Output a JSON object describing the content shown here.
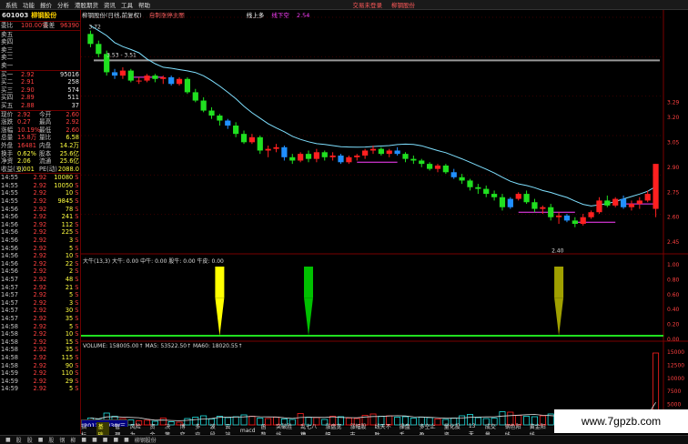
{
  "menu": {
    "items": [
      "系统",
      "功能",
      "报价",
      "分析",
      "港股期货",
      "资讯",
      "工具",
      "帮助"
    ],
    "right": [
      "交易未登录",
      "柳钢股份"
    ]
  },
  "stock": {
    "code": "601003",
    "name": "柳钢股份"
  },
  "order_book_top": [
    {
      "label": "委比",
      "v1": "100.00%",
      "l2": "委差",
      "v2": "96390"
    }
  ],
  "sells": [
    {
      "label": "卖五",
      "price": "",
      "vol": ""
    },
    {
      "label": "卖四",
      "price": "",
      "vol": ""
    },
    {
      "label": "卖三",
      "price": "",
      "vol": ""
    },
    {
      "label": "卖二",
      "price": "",
      "vol": ""
    },
    {
      "label": "卖一",
      "price": "",
      "vol": ""
    }
  ],
  "buys": [
    {
      "label": "买一",
      "price": "2.92",
      "vol": "95016"
    },
    {
      "label": "买二",
      "price": "2.91",
      "vol": "258"
    },
    {
      "label": "买三",
      "price": "2.90",
      "vol": "574"
    },
    {
      "label": "买四",
      "price": "2.89",
      "vol": "511"
    },
    {
      "label": "买五",
      "price": "2.88",
      "vol": "37"
    }
  ],
  "stats": [
    {
      "l1": "现价",
      "v1": "2.92",
      "l2": "今开",
      "v2": "2.60"
    },
    {
      "l1": "涨跌",
      "v1": "0.27",
      "l2": "最高",
      "v2": "2.92"
    },
    {
      "l1": "涨幅",
      "v1": "10.19%",
      "l2": "最低",
      "v2": "2.60"
    },
    {
      "l1": "总量",
      "v1": "15.8万",
      "l2": "量比",
      "v2": "6.58"
    },
    {
      "l1": "外盘",
      "v1": "16481",
      "l2": "内盘",
      "v2": "14.2万"
    },
    {
      "l1": "换手",
      "v1": "0.62%",
      "l2": "股本",
      "v2": "25.6亿"
    },
    {
      "l1": "净资",
      "v1": "2.06",
      "l2": "流通",
      "v2": "25.6亿"
    },
    {
      "l1": "收益(三)",
      "v1": "0.001",
      "l2": "PE(动)",
      "v2": "2088.0"
    }
  ],
  "ticks": [
    {
      "t": "14:55",
      "p": "2.92",
      "v": "10080",
      "d": "S"
    },
    {
      "t": "14:55",
      "p": "2.92",
      "v": "10050",
      "d": "S"
    },
    {
      "t": "14:55",
      "p": "2.92",
      "v": "10",
      "d": "S"
    },
    {
      "t": "14:55",
      "p": "2.92",
      "v": "9845",
      "d": "S"
    },
    {
      "t": "14:56",
      "p": "2.92",
      "v": "78",
      "d": "S"
    },
    {
      "t": "14:56",
      "p": "2.92",
      "v": "241",
      "d": "S"
    },
    {
      "t": "14:56",
      "p": "2.92",
      "v": "112",
      "d": "S"
    },
    {
      "t": "14:56",
      "p": "2.92",
      "v": "225",
      "d": "S"
    },
    {
      "t": "14:56",
      "p": "2.92",
      "v": "3",
      "d": "S"
    },
    {
      "t": "14:56",
      "p": "2.92",
      "v": "5",
      "d": "S"
    },
    {
      "t": "14:56",
      "p": "2.92",
      "v": "10",
      "d": "S"
    },
    {
      "t": "14:56",
      "p": "2.92",
      "v": "22",
      "d": "S"
    },
    {
      "t": "14:56",
      "p": "2.92",
      "v": "2",
      "d": "S"
    },
    {
      "t": "14:57",
      "p": "2.92",
      "v": "48",
      "d": "S"
    },
    {
      "t": "14:57",
      "p": "2.92",
      "v": "21",
      "d": "S"
    },
    {
      "t": "14:57",
      "p": "2.92",
      "v": "5",
      "d": "S"
    },
    {
      "t": "14:57",
      "p": "2.92",
      "v": "3",
      "d": "S"
    },
    {
      "t": "14:57",
      "p": "2.92",
      "v": "30",
      "d": "S"
    },
    {
      "t": "14:57",
      "p": "2.92",
      "v": "35",
      "d": "S"
    },
    {
      "t": "14:58",
      "p": "2.92",
      "v": "5",
      "d": "S"
    },
    {
      "t": "14:58",
      "p": "2.92",
      "v": "10",
      "d": "S"
    },
    {
      "t": "14:58",
      "p": "2.92",
      "v": "15",
      "d": "S"
    },
    {
      "t": "14:58",
      "p": "2.92",
      "v": "35",
      "d": "S"
    },
    {
      "t": "14:58",
      "p": "2.92",
      "v": "115",
      "d": "S"
    },
    {
      "t": "14:58",
      "p": "2.92",
      "v": "90",
      "d": "S"
    },
    {
      "t": "14:59",
      "p": "2.92",
      "v": "110",
      "d": "S"
    },
    {
      "t": "14:59",
      "p": "2.92",
      "v": "29",
      "d": "S"
    },
    {
      "t": "14:59",
      "p": "2.92",
      "v": "5",
      "d": "S"
    }
  ],
  "chart_title": [
    "柳钢股份(日线,前复权)",
    "自制涨停主图"
  ],
  "indicator_top": {
    "a": "线上多",
    "b": "线下空",
    "v": "2.54"
  },
  "price_labels": {
    "high": "3.72",
    "range": "3.53 - 3.51",
    "low": "2.40"
  },
  "y_price": [
    "3.29",
    "3.20",
    "3.05",
    "2.90",
    "2.75",
    "2.60",
    "2.45"
  ],
  "y_ind": [
    "1.00",
    "0.80",
    "0.60",
    "0.40",
    "0.20",
    "0.00"
  ],
  "y_vol": [
    "15000",
    "12500",
    "10000",
    "7500",
    "5000",
    "2500"
  ],
  "indicator_row": "大牛(13,3) 大牛: 0.00  中牛: 0.00  股牛: 0.00  牛皮: 0.00",
  "vol_row": "VOLUME: 158005.00↑  MA5: 53522.50↑  MA60: 18020.55↑",
  "date_label": "2012/05/30/三",
  "bottom_tabs": [
    "指标",
    "基础",
    "管理",
    "风险为",
    "资金",
    "决策",
    "博弈",
    "多空",
    "波段",
    "云端",
    "macd",
    "函数",
    "突破胜线",
    "乱七八糟",
    "涨盘宽幅",
    "涨幅股市",
    "线天不耽",
    "操盘手",
    "多空止盈",
    "量化投资",
    "13天",
    "成交量",
    "钢色阳线",
    "黄金阳线"
  ],
  "taskbar": [
    "■",
    "股",
    "股",
    "■",
    "股",
    "钢",
    "柳",
    "■",
    "■",
    "■",
    "■",
    "■",
    "柳钢股份"
  ],
  "watermark": "www.7gpzb.com",
  "candles": [
    [
      3.7,
      3.72,
      3.62,
      3.64
    ],
    [
      3.64,
      3.66,
      3.56,
      3.58
    ],
    [
      3.58,
      3.6,
      3.45,
      3.47
    ],
    [
      3.47,
      3.49,
      3.43,
      3.45
    ],
    [
      3.45,
      3.5,
      3.43,
      3.48
    ],
    [
      3.48,
      3.49,
      3.41,
      3.42
    ],
    [
      3.42,
      3.44,
      3.4,
      3.42
    ],
    [
      3.42,
      3.46,
      3.41,
      3.45
    ],
    [
      3.45,
      3.46,
      3.41,
      3.43
    ],
    [
      3.43,
      3.45,
      3.4,
      3.44
    ],
    [
      3.44,
      3.45,
      3.39,
      3.4
    ],
    [
      3.4,
      3.44,
      3.39,
      3.43
    ],
    [
      3.43,
      3.44,
      3.34,
      3.35
    ],
    [
      3.35,
      3.37,
      3.29,
      3.3
    ],
    [
      3.3,
      3.32,
      3.23,
      3.24
    ],
    [
      3.24,
      3.26,
      3.19,
      3.21
    ],
    [
      3.21,
      3.22,
      3.15,
      3.18
    ],
    [
      3.18,
      3.19,
      3.13,
      3.15
    ],
    [
      3.15,
      3.17,
      3.08,
      3.1
    ],
    [
      3.1,
      3.12,
      3.04,
      3.05
    ],
    [
      3.05,
      3.1,
      3.04,
      3.08
    ],
    [
      3.08,
      3.09,
      2.98,
      3.0
    ],
    [
      3.0,
      3.03,
      2.96,
      3.01
    ],
    [
      3.01,
      3.04,
      2.99,
      3.02
    ],
    [
      3.02,
      3.03,
      2.94,
      2.96
    ],
    [
      2.96,
      2.98,
      2.92,
      2.94
    ],
    [
      2.94,
      2.99,
      2.93,
      2.98
    ],
    [
      2.98,
      3.0,
      2.93,
      2.95
    ],
    [
      2.95,
      3.01,
      2.93,
      2.99
    ],
    [
      2.99,
      3.0,
      2.94,
      2.96
    ],
    [
      2.96,
      2.99,
      2.94,
      2.97
    ],
    [
      2.97,
      2.98,
      2.92,
      2.93
    ],
    [
      2.93,
      2.97,
      2.92,
      2.96
    ],
    [
      2.96,
      2.98,
      2.94,
      2.97
    ],
    [
      2.97,
      3.01,
      2.95,
      3.0
    ],
    [
      3.0,
      3.03,
      2.98,
      3.01
    ],
    [
      3.01,
      3.02,
      2.97,
      2.98
    ],
    [
      2.98,
      3.01,
      2.96,
      3.0
    ],
    [
      3.0,
      3.02,
      2.97,
      2.98
    ],
    [
      2.98,
      2.99,
      2.93,
      2.95
    ],
    [
      2.95,
      2.97,
      2.92,
      2.94
    ],
    [
      2.94,
      2.95,
      2.9,
      2.92
    ],
    [
      2.92,
      2.93,
      2.88,
      2.89
    ],
    [
      2.89,
      2.92,
      2.87,
      2.91
    ],
    [
      2.91,
      2.92,
      2.86,
      2.87
    ],
    [
      2.87,
      2.89,
      2.83,
      2.84
    ],
    [
      2.84,
      2.86,
      2.8,
      2.82
    ],
    [
      2.82,
      2.83,
      2.76,
      2.78
    ],
    [
      2.78,
      2.8,
      2.74,
      2.77
    ],
    [
      2.77,
      2.79,
      2.72,
      2.74
    ],
    [
      2.74,
      2.76,
      2.7,
      2.72
    ],
    [
      2.72,
      2.74,
      2.64,
      2.66
    ],
    [
      2.66,
      2.72,
      2.65,
      2.71
    ],
    [
      2.71,
      2.75,
      2.7,
      2.74
    ],
    [
      2.74,
      2.76,
      2.68,
      2.69
    ],
    [
      2.69,
      2.71,
      2.63,
      2.65
    ],
    [
      2.65,
      2.67,
      2.62,
      2.66
    ],
    [
      2.66,
      2.68,
      2.58,
      2.6
    ],
    [
      2.6,
      2.63,
      2.56,
      2.61
    ],
    [
      2.61,
      2.62,
      2.57,
      2.58
    ],
    [
      2.58,
      2.6,
      2.54,
      2.56
    ],
    [
      2.56,
      2.62,
      2.55,
      2.6
    ],
    [
      2.6,
      2.64,
      2.59,
      2.63
    ],
    [
      2.63,
      2.72,
      2.62,
      2.7
    ],
    [
      2.7,
      2.73,
      2.66,
      2.67
    ],
    [
      2.67,
      2.72,
      2.66,
      2.71
    ],
    [
      2.71,
      2.73,
      2.65,
      2.66
    ],
    [
      2.66,
      2.7,
      2.64,
      2.68
    ],
    [
      2.68,
      2.72,
      2.65,
      2.7
    ],
    [
      2.7,
      2.76,
      2.69,
      2.74
    ],
    [
      2.65,
      2.92,
      2.6,
      2.92
    ]
  ],
  "signal_bars": [
    {
      "idx": 16,
      "color": "#ffff00",
      "h": 1.0
    },
    {
      "idx": 27,
      "color": "#00c000",
      "h": 1.0
    },
    {
      "idx": 58,
      "color": "#a0a000",
      "h": 1.0
    }
  ],
  "volumes": [
    1500,
    1200,
    2600,
    1900,
    1400,
    1100,
    900,
    1000,
    800,
    1500,
    700,
    600,
    1400,
    1700,
    2000,
    1300,
    1900,
    1600,
    1800,
    2200,
    1900,
    1500,
    1400,
    1700,
    1300,
    1200,
    2500,
    1700,
    1600,
    1200,
    1900,
    1800,
    1500,
    1400,
    2100,
    2400,
    1900,
    2000,
    1700,
    1800,
    1500,
    1700,
    1600,
    1300,
    1200,
    1500,
    2000,
    2300,
    1600,
    1400,
    1500,
    2900,
    2800,
    2100,
    1900,
    1800,
    2000,
    2400,
    1500,
    1700,
    1600,
    1900,
    2300,
    2500,
    2200,
    1700,
    2400,
    1900,
    2100,
    2600,
    15800
  ]
}
